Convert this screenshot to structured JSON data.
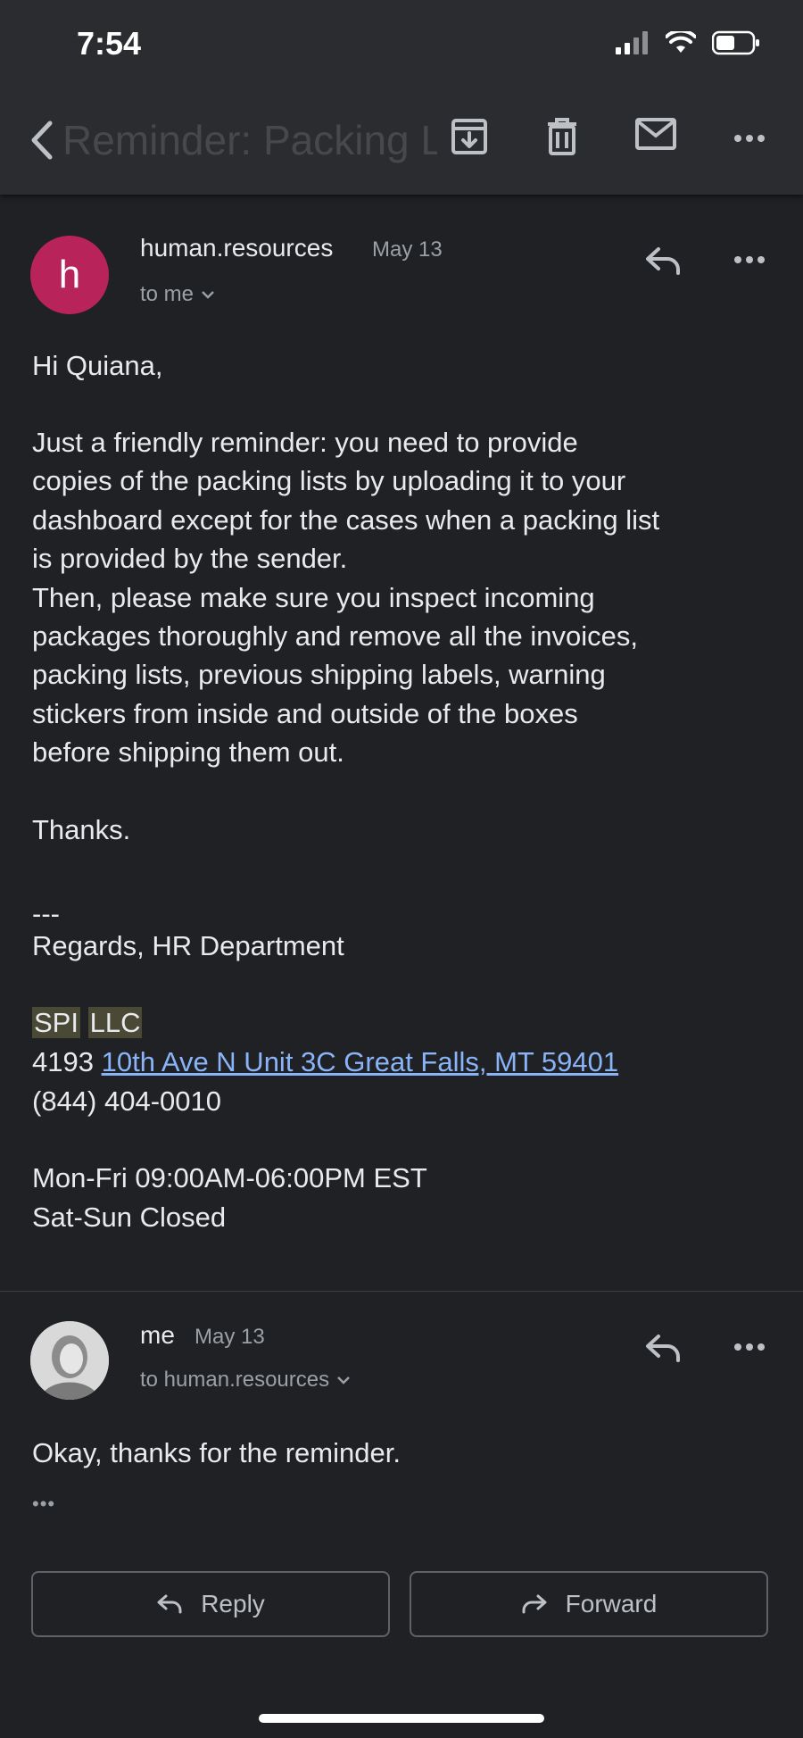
{
  "status_bar": {
    "time": "7:54"
  },
  "toolbar": {
    "subject": "Reminder: Packing List"
  },
  "message1": {
    "avatar_letter": "h",
    "sender": "human.resources",
    "date": "May 13",
    "recipient": "to me",
    "greeting": "Hi Quiana,",
    "paragraph": "Just a friendly reminder: you need to provide\ncopies of the packing lists by uploading it to your\ndashboard except for the cases when a packing list\nis provided by the sender.\nThen, please make sure you inspect incoming\npackages thoroughly and remove all the invoices,\npacking lists, previous shipping labels, warning\nstickers from inside and outside of the boxes\nbefore shipping them out.",
    "thanks": "Thanks.",
    "sig_dashes": "---",
    "sig_regards": "Regards, HR Department",
    "company_word1": "SPI",
    "company_word2": "LLC",
    "address_number": "4193",
    "address_link": "10th Ave N Unit 3C Great Falls, MT 59401",
    "phone": "(844) 404-0010",
    "hours_weekday": "Mon-Fri 09:00AM-06:00PM EST",
    "hours_weekend": "Sat-Sun Closed"
  },
  "message2": {
    "sender": "me",
    "date": "May 13",
    "recipient": "to human.resources",
    "body": "Okay, thanks for the reminder.",
    "trimmed": "•••"
  },
  "actions": {
    "reply_label": "Reply",
    "forward_label": "Forward"
  }
}
